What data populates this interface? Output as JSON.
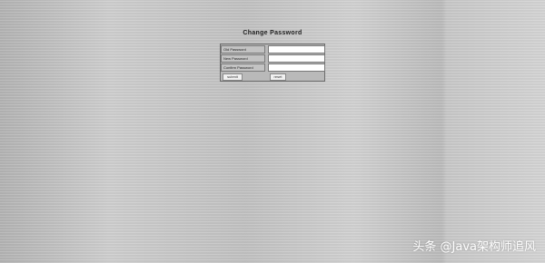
{
  "page": {
    "title": "Change Password"
  },
  "form": {
    "fields": [
      {
        "label": "Old Password",
        "value": ""
      },
      {
        "label": "New Password",
        "value": ""
      },
      {
        "label": "Confirm Password",
        "value": ""
      }
    ],
    "submit_label": "submit",
    "reset_label": "reset"
  },
  "watermark": {
    "text": "头条 @Java架构师追风"
  }
}
